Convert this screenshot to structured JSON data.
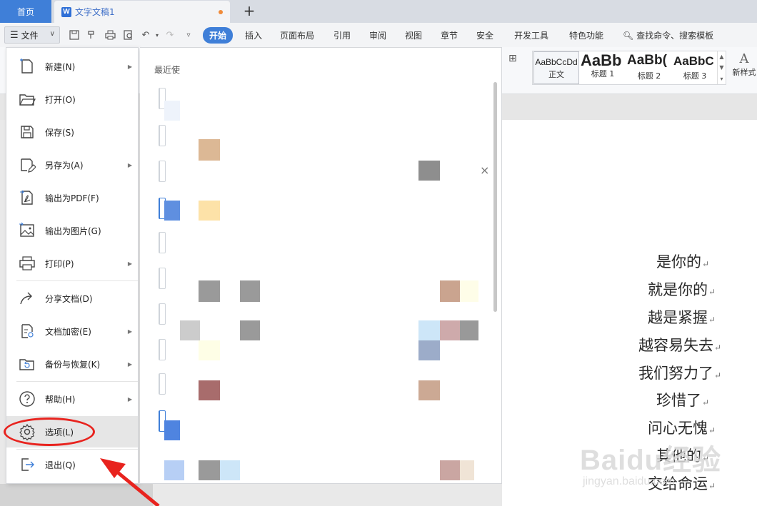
{
  "tabs": {
    "home_label": "首页",
    "doc_title": "文字文稿1",
    "doc_icon_letter": "W",
    "add_label": "+"
  },
  "toolbar": {
    "file_label": "文件",
    "menu_tabs": [
      "开始",
      "插入",
      "页面布局",
      "引用",
      "审阅",
      "视图",
      "章节",
      "安全",
      "开发工具",
      "特色功能"
    ],
    "active_tab": "开始",
    "search_label": "查找命令、搜索模板",
    "accent_color": "#3f7fd8"
  },
  "styles_gallery": [
    {
      "sample": "AaBbCcDd",
      "name": "正文"
    },
    {
      "sample": "AaBb",
      "name": "标题 1"
    },
    {
      "sample": "AaBb(",
      "name": "标题 2"
    },
    {
      "sample": "AaBbC",
      "name": "标题 3"
    }
  ],
  "new_style": {
    "icon": "A",
    "label": "新样式"
  },
  "file_menu": {
    "items": [
      {
        "label": "新建(N)",
        "icon": "new-doc-icon",
        "submenu": true
      },
      {
        "label": "打开(O)",
        "icon": "folder-open-icon",
        "submenu": false
      },
      {
        "label": "保存(S)",
        "icon": "save-icon",
        "submenu": false
      },
      {
        "label": "另存为(A)",
        "icon": "save-as-icon",
        "submenu": true
      },
      {
        "label": "输出为PDF(F)",
        "icon": "pdf-export-icon",
        "submenu": false
      },
      {
        "label": "输出为图片(G)",
        "icon": "image-export-icon",
        "submenu": false
      },
      {
        "label": "打印(P)",
        "icon": "printer-icon",
        "submenu": true
      },
      {
        "label": "分享文档(D)",
        "icon": "share-icon",
        "submenu": false
      },
      {
        "label": "文档加密(E)",
        "icon": "encrypt-doc-icon",
        "submenu": true
      },
      {
        "label": "备份与恢复(K)",
        "icon": "backup-icon",
        "submenu": true
      },
      {
        "label": "帮助(H)",
        "icon": "help-icon",
        "submenu": true
      },
      {
        "label": "选项(L)",
        "icon": "gear-icon",
        "submenu": false,
        "selected": true
      },
      {
        "label": "退出(Q)",
        "icon": "exit-icon",
        "submenu": false
      }
    ]
  },
  "recent_panel": {
    "title": "最近使",
    "close_label": "×"
  },
  "document": {
    "lines": [
      "是你的",
      "就是你的",
      "越是紧握",
      "越容易失去",
      "我们努力了",
      "珍惜了",
      "问心无愧",
      "其他的",
      "交给命运"
    ],
    "paragraph_mark": "↵"
  },
  "watermark": {
    "brand": "Baidu经验",
    "url": "jingyan.baidu.com"
  },
  "annotation_color": "#e8231e"
}
